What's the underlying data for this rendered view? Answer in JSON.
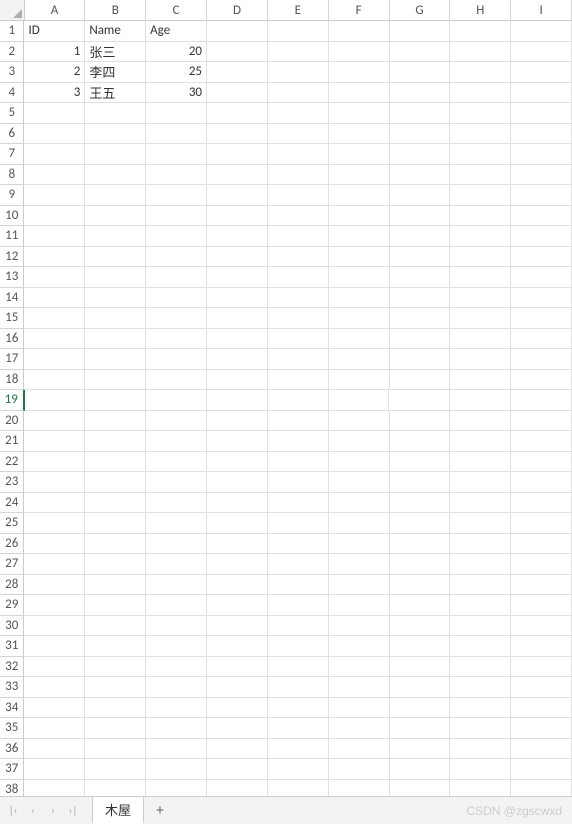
{
  "columns": [
    "A",
    "B",
    "C",
    "D",
    "E",
    "F",
    "G",
    "H",
    "I"
  ],
  "rowCount": 38,
  "activeRow": 19,
  "headers": {
    "c0": "ID",
    "c1": "Name",
    "c2": "Age"
  },
  "data": [
    {
      "id": "1",
      "name": "张三",
      "age": "20"
    },
    {
      "id": "2",
      "name": "李四",
      "age": "25"
    },
    {
      "id": "3",
      "name": "王五",
      "age": "30"
    }
  ],
  "sheet": {
    "name": "木屋",
    "addLabel": "+"
  },
  "nav": {
    "first": "|‹",
    "prev": "‹",
    "next": "›",
    "last": "›|"
  },
  "watermark": "CSDN @zgscwxd"
}
